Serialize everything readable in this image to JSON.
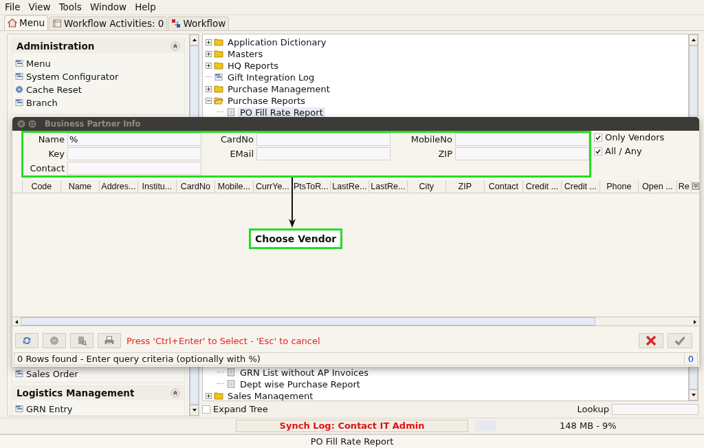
{
  "menu_bar": [
    {
      "label": "File"
    },
    {
      "label": "View"
    },
    {
      "label": "Tools"
    },
    {
      "label": "Window"
    },
    {
      "label": "Help"
    }
  ],
  "tabs": [
    {
      "label": "Menu",
      "kind": "home",
      "selected": true
    },
    {
      "label": "Workflow Activities: 0",
      "kind": "activities",
      "selected": false
    },
    {
      "label": "Workflow",
      "kind": "workflow",
      "selected": false
    }
  ],
  "menu_panel": {
    "sections": [
      {
        "title": "Administration",
        "items": [
          {
            "label": "Menu",
            "kind": "window"
          },
          {
            "label": "System Configurator",
            "kind": "window"
          },
          {
            "label": "Cache Reset",
            "kind": "process"
          },
          {
            "label": "Branch",
            "kind": "window"
          }
        ]
      },
      {
        "items": [
          {
            "label": "Sales Order",
            "kind": "window"
          }
        ]
      },
      {
        "title": "Logistics Management",
        "items": [
          {
            "label": "GRN Entry",
            "kind": "window"
          }
        ]
      }
    ]
  },
  "tree": {
    "items": [
      {
        "label": "Application Dictionary",
        "kind": "folder",
        "expanded": false
      },
      {
        "label": "Masters",
        "kind": "folder",
        "expanded": false
      },
      {
        "label": "HQ Reports",
        "kind": "folder",
        "expanded": false
      },
      {
        "label": "Gift Integration Log",
        "kind": "window"
      },
      {
        "label": "Purchase Management",
        "kind": "folder",
        "expanded": false
      },
      {
        "label": "Purchase Reports",
        "kind": "folder",
        "expanded": true,
        "children": [
          {
            "label": "PO Fill Rate Report",
            "kind": "report",
            "selected": true
          },
          {
            "label": "GRN List without AP Invoices",
            "kind": "report",
            "selected": false
          },
          {
            "label": "Dept wise Purchase Report",
            "kind": "report",
            "selected": false
          }
        ]
      },
      {
        "label": "Sales Management",
        "kind": "folder",
        "expanded": false
      }
    ]
  },
  "expand_tree": {
    "label": "Expand Tree",
    "checked": false
  },
  "lookup": {
    "label": "Lookup"
  },
  "status_bar": {
    "synch_log": "Synch Log: Contact IT Admin",
    "memory": "148 MB - 9%"
  },
  "footer": {
    "title": "PO Fill Rate Report"
  },
  "dialog": {
    "title": "Business Partner Info",
    "fields": [
      {
        "label": "Name",
        "value": "%"
      },
      {
        "label": "CardNo"
      },
      {
        "label": "MobileNo"
      },
      {
        "label": "Key"
      },
      {
        "label": "EMail"
      },
      {
        "label": "ZIP"
      },
      {
        "label": "Contact"
      }
    ],
    "options": [
      {
        "label": "Only Vendors",
        "checked": true
      },
      {
        "label": "All / Any",
        "checked": true
      }
    ],
    "table": {
      "columns": [
        "Code",
        "Name",
        "Addres...",
        "Institu...",
        "CardNo",
        "Mobile...",
        "CurrYe...",
        "PtsToR...",
        "LastRe...",
        "LastRe...",
        "City",
        "ZIP",
        "Contact",
        "Credit ...",
        "Credit ...",
        "Phone",
        "Open ...",
        "Re"
      ]
    },
    "tools": [
      {
        "kind": "refresh",
        "disabled": false
      },
      {
        "kind": "history",
        "disabled": true
      },
      {
        "kind": "zoom",
        "disabled": true
      },
      {
        "kind": "print",
        "disabled": false
      }
    ],
    "hint": "Press 'Ctrl+Enter' to Select - 'Esc' to cancel",
    "actions": [
      {
        "kind": "cancel",
        "disabled": false
      },
      {
        "kind": "ok",
        "disabled": true
      }
    ],
    "status": "0 Rows found - Enter query criteria (optionally with %)",
    "count": "0"
  },
  "annotation": {
    "label": "Choose Vendor"
  }
}
